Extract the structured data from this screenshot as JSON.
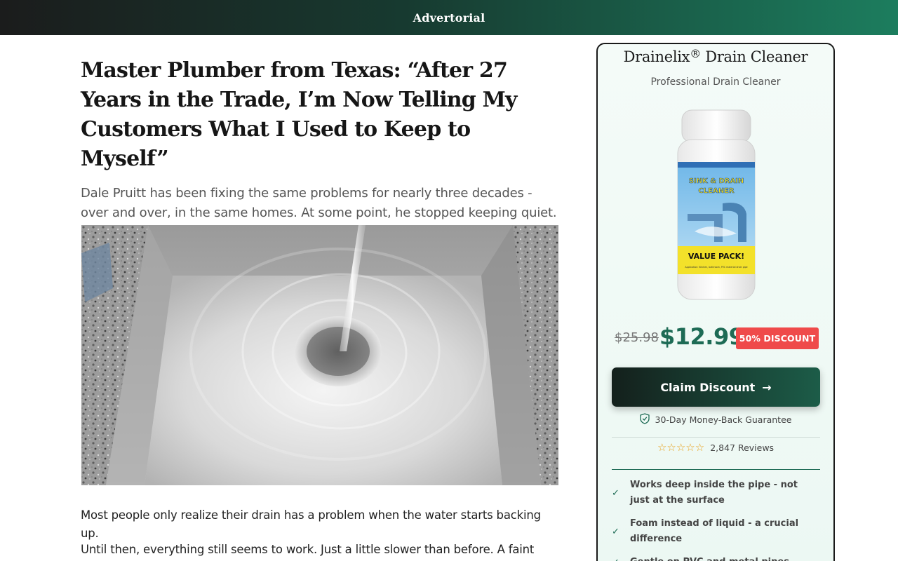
{
  "topbar": {
    "label": "Advertorial"
  },
  "article": {
    "headline": "Master Plumber from Texas: “After 27 Years in the Trade, I’m Now Telling My Customers What I Used to Keep to Myself”",
    "subhead": "Dale Pruitt has been fixing the same problems for nearly three decades - over and over, in the same homes. At some point, he stopped keeping quiet.",
    "paragraphs": [
      "Most people only realize their drain has a problem when the water starts backing up.",
      "Until then, everything still seems to work. Just a little slower than before. A faint smell"
    ]
  },
  "product": {
    "name": "Drainelix",
    "name_mark": "®",
    "name_suffix": " Drain Cleaner",
    "subtitle": "Professional Drain Cleaner",
    "bottle_label_top": "SINK & DRAIN",
    "bottle_label_mid": "CLEANER",
    "bottle_label_pack": "VALUE PACK!",
    "bottle_label_small": "Application: Kitchen, bathroom, PVC material drain pipe",
    "old_price": "$25.98",
    "new_price": "$12.99",
    "discount_badge": "50% DISCOUNT",
    "cta_label": "Claim Discount",
    "guarantee": "30-Day Money-Back Guarantee",
    "stars": "☆☆☆☆☆",
    "reviews": "2,847 Reviews",
    "features": [
      "Works deep inside the pipe - not just at the surface",
      "Foam instead of liquid - a crucial difference",
      "Gentle on PVC and metal pipes"
    ]
  },
  "colors": {
    "brand_green": "#1e6b55",
    "badge_red": "#ef4a4a",
    "star": "#e8a11a"
  }
}
